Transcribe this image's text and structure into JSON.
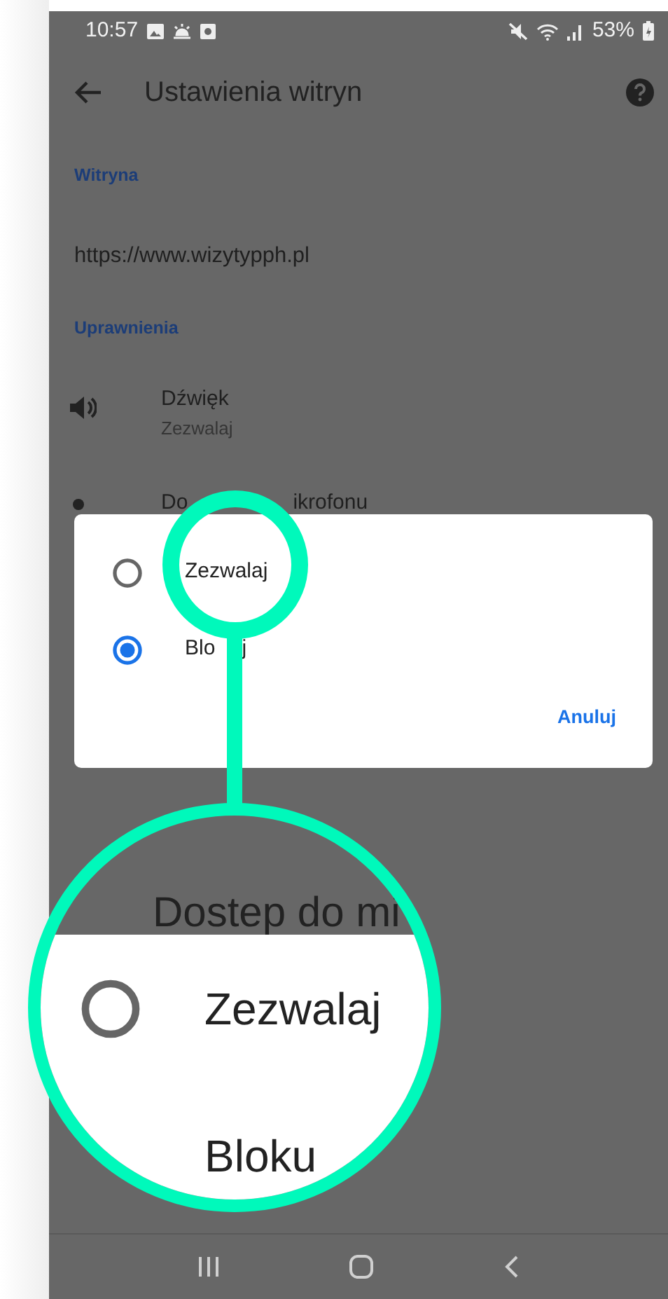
{
  "status_bar": {
    "time": "10:57",
    "battery": "53%"
  },
  "app_bar": {
    "title": "Ustawienia witryn"
  },
  "sections": [
    {
      "header": "Witryna",
      "items": [
        {
          "kind": "url",
          "title": "https://www.wizytypph.pl"
        }
      ]
    },
    {
      "header": "Uprawnienia",
      "items": [
        {
          "kind": "sound",
          "title": "Dźwięk",
          "subtitle": "Zezwalaj"
        },
        {
          "kind": "mic",
          "title_parts": [
            "Do",
            "ikrofonu"
          ]
        }
      ]
    }
  ],
  "dialog": {
    "options": [
      {
        "label_parts": [
          "Zezwalaj"
        ],
        "selected": false
      },
      {
        "label_parts": [
          "Blo",
          "j"
        ],
        "selected": true
      }
    ],
    "button": "Anuluj"
  },
  "magnifier": {
    "background_text": "Dostep do mi",
    "options": [
      {
        "label": "Zezwalaj",
        "selected": false
      },
      {
        "label": "Bloku"
      }
    ]
  }
}
